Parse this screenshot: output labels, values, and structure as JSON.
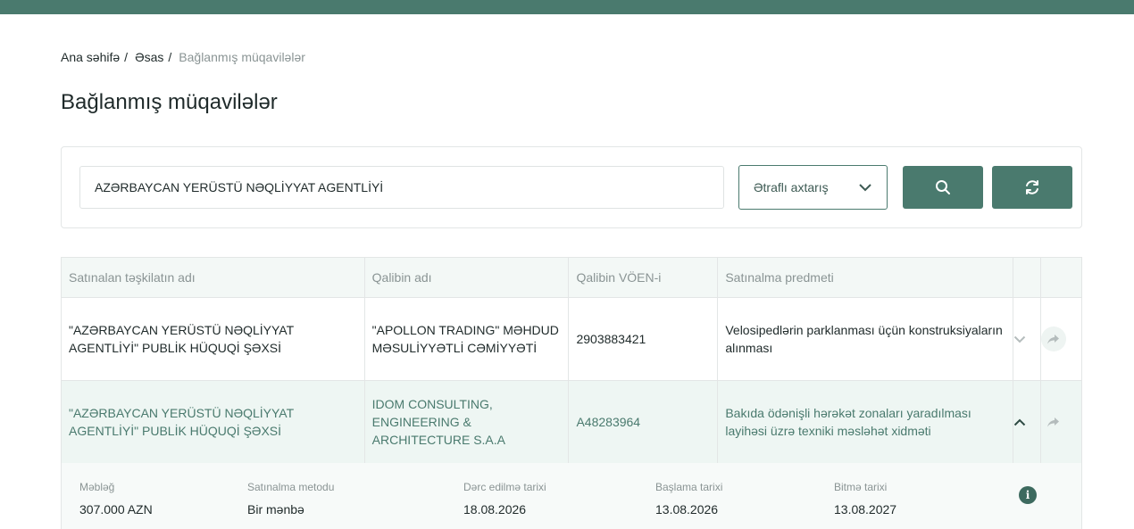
{
  "breadcrumb": {
    "home": "Ana səhifə",
    "main": "Əsas",
    "current": "Bağlanmış müqavilələr",
    "separator": "/"
  },
  "page": {
    "title": "Bağlanmış müqavilələr"
  },
  "search": {
    "value": "AZƏRBAYCAN YERÜSTÜ NƏQLİYYAT AGENTLİYİ",
    "advanced_label": "Ətraflı axtarış"
  },
  "table": {
    "headers": [
      "Satınalan təşkilatın adı",
      "Qalibin adı",
      "Qalibin VÖEN-i",
      "Satınalma predmeti"
    ],
    "rows": [
      {
        "buyer": "\"AZƏRBAYCAN YERÜSTÜ NƏQLİYYAT AGENTLİYİ\" PUBLİK HÜQUQİ ŞƏXSİ",
        "winner": "\"APOLLON TRADING\" MƏHDUD MƏSULİYYƏTLİ CƏMİYYƏTİ",
        "voen": "2903883421",
        "subject": "Velosipedlərin parklanması üçün konstruksiyaların alınması"
      },
      {
        "buyer": "\"AZƏRBAYCAN YERÜSTÜ NƏQLİYYAT AGENTLİYİ\" PUBLİK HÜQUQİ ŞƏXSİ",
        "winner": "IDOM CONSULTING, ENGINEERING & ARCHITECTURE S.A.A",
        "voen": "A48283964",
        "subject": "Bakıda ödənişli hərəkət zonaları yaradılması layihəsi üzrə texniki məsləhət xidməti"
      }
    ]
  },
  "details": {
    "amount_label": "Məbləğ",
    "amount": "307.000 AZN",
    "method_label": "Satınalma metodu",
    "method": "Bir mənbə",
    "published_label": "Dərc edilmə tarixi",
    "published": "18.08.2026",
    "start_label": "Başlama tarixi",
    "start": "13.08.2026",
    "end_label": "Bitmə tarixi",
    "end": "13.08.2027"
  },
  "colors": {
    "accent": "#4a7a6e",
    "row_expanded": "#eef6f3",
    "header_bg": "#f3f8f6"
  }
}
